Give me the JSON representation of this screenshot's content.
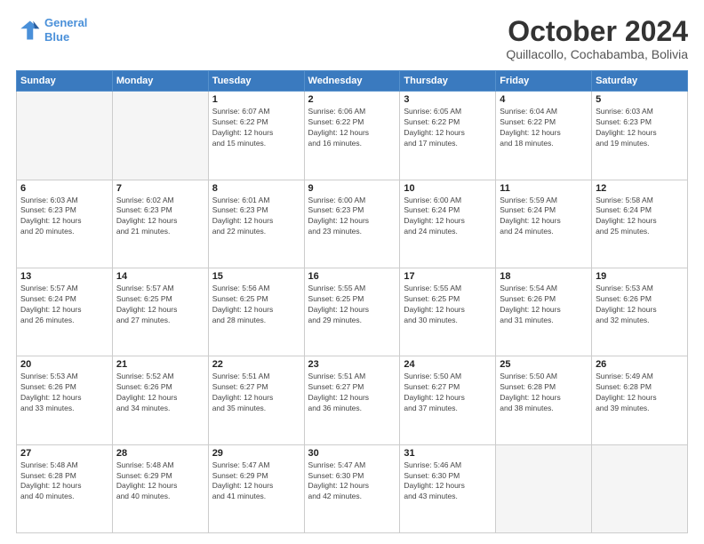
{
  "logo": {
    "line1": "General",
    "line2": "Blue"
  },
  "header": {
    "month": "October 2024",
    "location": "Quillacollo, Cochabamba, Bolivia"
  },
  "weekdays": [
    "Sunday",
    "Monday",
    "Tuesday",
    "Wednesday",
    "Thursday",
    "Friday",
    "Saturday"
  ],
  "weeks": [
    [
      {
        "day": "",
        "info": ""
      },
      {
        "day": "",
        "info": ""
      },
      {
        "day": "1",
        "info": "Sunrise: 6:07 AM\nSunset: 6:22 PM\nDaylight: 12 hours\nand 15 minutes."
      },
      {
        "day": "2",
        "info": "Sunrise: 6:06 AM\nSunset: 6:22 PM\nDaylight: 12 hours\nand 16 minutes."
      },
      {
        "day": "3",
        "info": "Sunrise: 6:05 AM\nSunset: 6:22 PM\nDaylight: 12 hours\nand 17 minutes."
      },
      {
        "day": "4",
        "info": "Sunrise: 6:04 AM\nSunset: 6:22 PM\nDaylight: 12 hours\nand 18 minutes."
      },
      {
        "day": "5",
        "info": "Sunrise: 6:03 AM\nSunset: 6:23 PM\nDaylight: 12 hours\nand 19 minutes."
      }
    ],
    [
      {
        "day": "6",
        "info": "Sunrise: 6:03 AM\nSunset: 6:23 PM\nDaylight: 12 hours\nand 20 minutes."
      },
      {
        "day": "7",
        "info": "Sunrise: 6:02 AM\nSunset: 6:23 PM\nDaylight: 12 hours\nand 21 minutes."
      },
      {
        "day": "8",
        "info": "Sunrise: 6:01 AM\nSunset: 6:23 PM\nDaylight: 12 hours\nand 22 minutes."
      },
      {
        "day": "9",
        "info": "Sunrise: 6:00 AM\nSunset: 6:23 PM\nDaylight: 12 hours\nand 23 minutes."
      },
      {
        "day": "10",
        "info": "Sunrise: 6:00 AM\nSunset: 6:24 PM\nDaylight: 12 hours\nand 24 minutes."
      },
      {
        "day": "11",
        "info": "Sunrise: 5:59 AM\nSunset: 6:24 PM\nDaylight: 12 hours\nand 24 minutes."
      },
      {
        "day": "12",
        "info": "Sunrise: 5:58 AM\nSunset: 6:24 PM\nDaylight: 12 hours\nand 25 minutes."
      }
    ],
    [
      {
        "day": "13",
        "info": "Sunrise: 5:57 AM\nSunset: 6:24 PM\nDaylight: 12 hours\nand 26 minutes."
      },
      {
        "day": "14",
        "info": "Sunrise: 5:57 AM\nSunset: 6:25 PM\nDaylight: 12 hours\nand 27 minutes."
      },
      {
        "day": "15",
        "info": "Sunrise: 5:56 AM\nSunset: 6:25 PM\nDaylight: 12 hours\nand 28 minutes."
      },
      {
        "day": "16",
        "info": "Sunrise: 5:55 AM\nSunset: 6:25 PM\nDaylight: 12 hours\nand 29 minutes."
      },
      {
        "day": "17",
        "info": "Sunrise: 5:55 AM\nSunset: 6:25 PM\nDaylight: 12 hours\nand 30 minutes."
      },
      {
        "day": "18",
        "info": "Sunrise: 5:54 AM\nSunset: 6:26 PM\nDaylight: 12 hours\nand 31 minutes."
      },
      {
        "day": "19",
        "info": "Sunrise: 5:53 AM\nSunset: 6:26 PM\nDaylight: 12 hours\nand 32 minutes."
      }
    ],
    [
      {
        "day": "20",
        "info": "Sunrise: 5:53 AM\nSunset: 6:26 PM\nDaylight: 12 hours\nand 33 minutes."
      },
      {
        "day": "21",
        "info": "Sunrise: 5:52 AM\nSunset: 6:26 PM\nDaylight: 12 hours\nand 34 minutes."
      },
      {
        "day": "22",
        "info": "Sunrise: 5:51 AM\nSunset: 6:27 PM\nDaylight: 12 hours\nand 35 minutes."
      },
      {
        "day": "23",
        "info": "Sunrise: 5:51 AM\nSunset: 6:27 PM\nDaylight: 12 hours\nand 36 minutes."
      },
      {
        "day": "24",
        "info": "Sunrise: 5:50 AM\nSunset: 6:27 PM\nDaylight: 12 hours\nand 37 minutes."
      },
      {
        "day": "25",
        "info": "Sunrise: 5:50 AM\nSunset: 6:28 PM\nDaylight: 12 hours\nand 38 minutes."
      },
      {
        "day": "26",
        "info": "Sunrise: 5:49 AM\nSunset: 6:28 PM\nDaylight: 12 hours\nand 39 minutes."
      }
    ],
    [
      {
        "day": "27",
        "info": "Sunrise: 5:48 AM\nSunset: 6:28 PM\nDaylight: 12 hours\nand 40 minutes."
      },
      {
        "day": "28",
        "info": "Sunrise: 5:48 AM\nSunset: 6:29 PM\nDaylight: 12 hours\nand 40 minutes."
      },
      {
        "day": "29",
        "info": "Sunrise: 5:47 AM\nSunset: 6:29 PM\nDaylight: 12 hours\nand 41 minutes."
      },
      {
        "day": "30",
        "info": "Sunrise: 5:47 AM\nSunset: 6:30 PM\nDaylight: 12 hours\nand 42 minutes."
      },
      {
        "day": "31",
        "info": "Sunrise: 5:46 AM\nSunset: 6:30 PM\nDaylight: 12 hours\nand 43 minutes."
      },
      {
        "day": "",
        "info": ""
      },
      {
        "day": "",
        "info": ""
      }
    ]
  ]
}
